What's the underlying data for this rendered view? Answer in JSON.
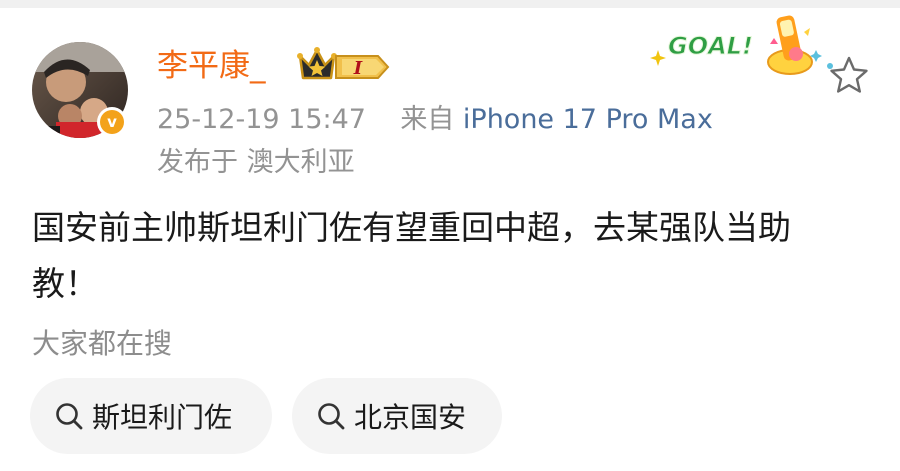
{
  "post": {
    "author": {
      "name": "李平康_",
      "verified_badge_letter": "v",
      "level_badge_text": "I"
    },
    "timestamp": "25-12-19 15:47",
    "source_prefix": "来自",
    "source_device": "iPhone 17 Pro Max",
    "location": "发布于 澳大利亚",
    "content": "国安前主帅斯坦利门佐有望重回中超，去某强队当助教！",
    "sticker_text": "GOAL!"
  },
  "search": {
    "heading": "大家都在搜",
    "chips": [
      {
        "label": "斯坦利门佐",
        "icon": "search-icon"
      },
      {
        "label": "北京国安",
        "icon": "search-icon"
      }
    ]
  },
  "icons": {
    "favorite": "star-icon"
  },
  "colors": {
    "username": "#f26a15",
    "meta": "#939393",
    "device_link": "#4a6d9a",
    "text": "#1a1a1a",
    "chip_bg": "#f4f4f4",
    "verified_badge": "#f3a21a"
  }
}
